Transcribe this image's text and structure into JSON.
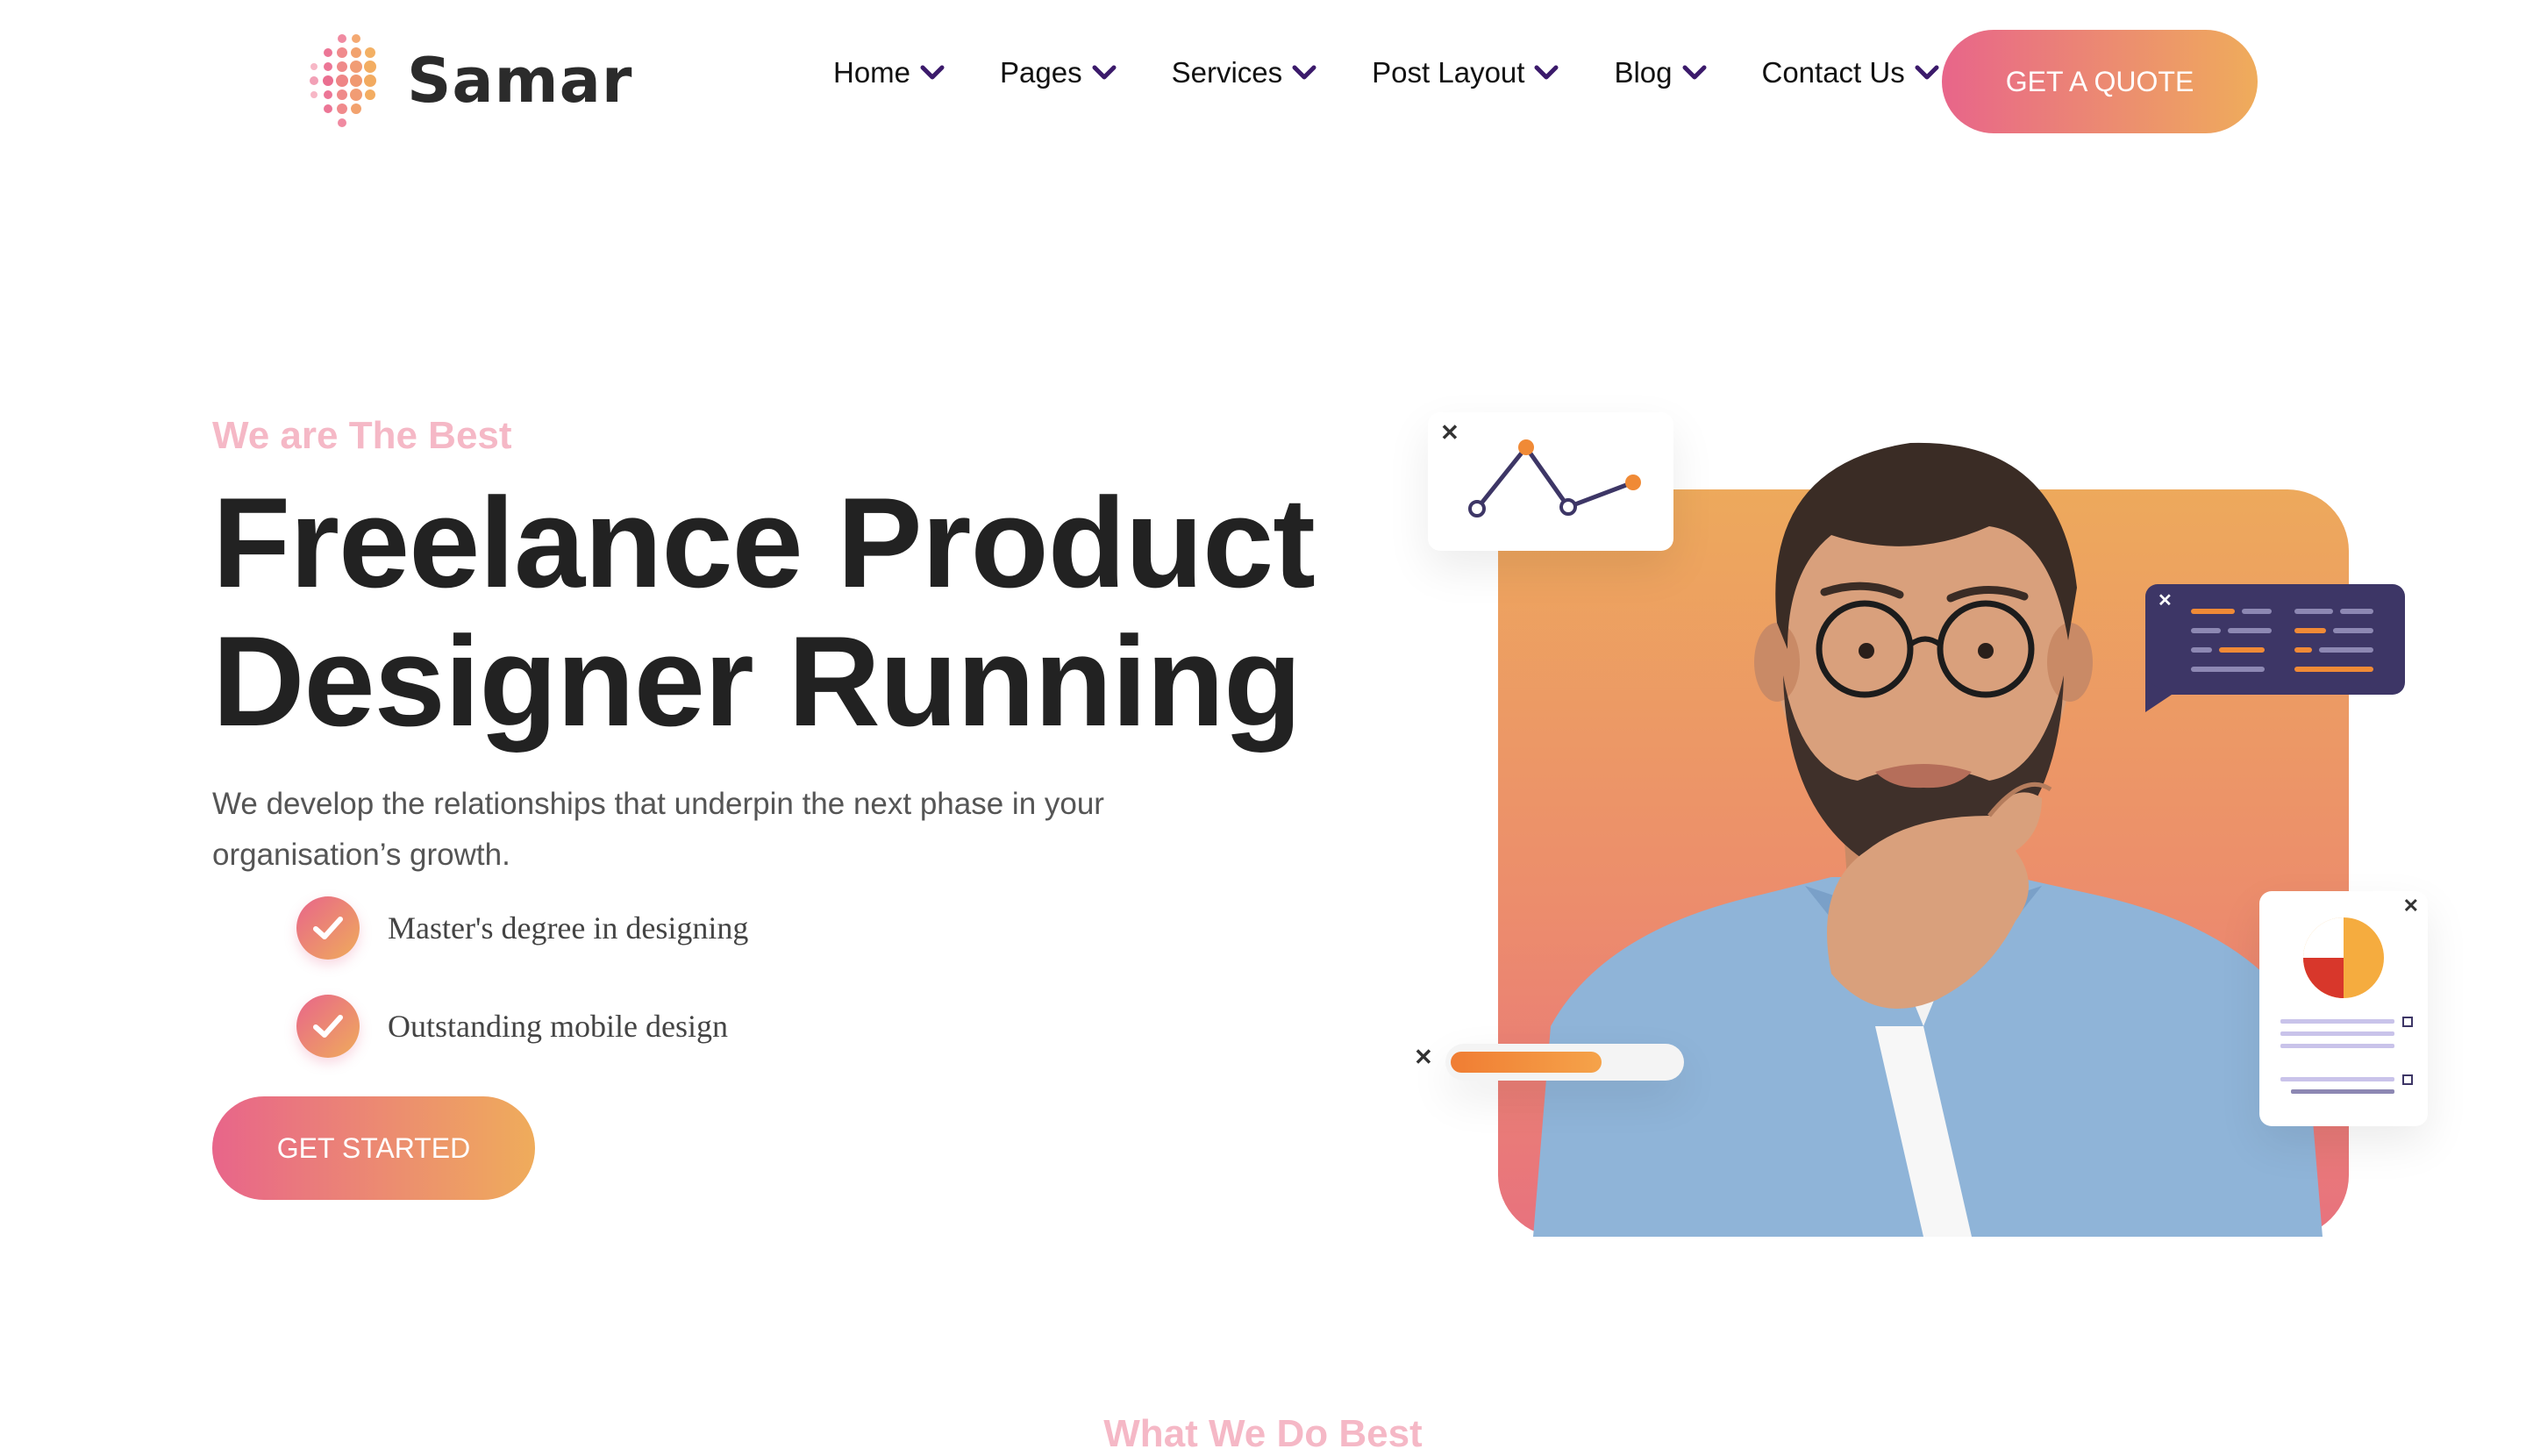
{
  "brand": {
    "name": "Samar",
    "gradient_start": "#e8658a",
    "gradient_end": "#efac5b"
  },
  "nav": {
    "items": [
      {
        "label": "Home",
        "icon": "chevron-down-icon"
      },
      {
        "label": "Pages",
        "icon": "chevron-down-icon"
      },
      {
        "label": "Services",
        "icon": "chevron-down-icon"
      },
      {
        "label": "Post Layout",
        "icon": "chevron-down-icon"
      },
      {
        "label": "Blog",
        "icon": "chevron-down-icon"
      },
      {
        "label": "Contact Us",
        "icon": "chevron-down-icon"
      }
    ],
    "cta_label": "GET A QUOTE",
    "chevron_color": "#3b1a6b"
  },
  "hero": {
    "tagline": "We are The Best",
    "title_line1": "Freelance Product",
    "title_line2": "Designer Running",
    "description": "We develop the relationships that underpin the next phase in your organisation’s growth.",
    "checklist": [
      {
        "text": "Master's degree in designing",
        "icon": "check-icon"
      },
      {
        "text": "Outstanding mobile design",
        "icon": "check-icon"
      }
    ],
    "cta_label": "GET STARTED"
  },
  "next_section": {
    "label": "What We Do Best"
  },
  "colors": {
    "tagline": "#f5b8c6",
    "title": "#222222",
    "body": "#555555",
    "widget_dark": "#3d3666"
  }
}
